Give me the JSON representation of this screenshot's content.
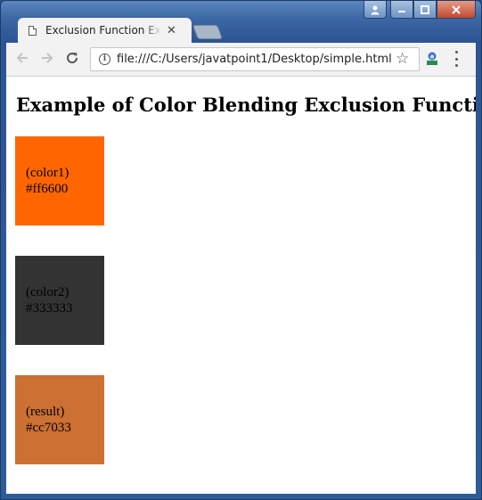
{
  "window": {
    "user_icon": "user-icon",
    "min_icon": "minimize-icon",
    "max_icon": "maximize-icon",
    "close_icon": "close-icon"
  },
  "tab": {
    "title": "Exclusion Function Example",
    "close_label": "✕"
  },
  "toolbar": {
    "url": "file:///C:/Users/javatpoint1/Desktop/simple.html",
    "back_icon": "back-arrow-icon",
    "forward_icon": "forward-arrow-icon",
    "reload_icon": "reload-icon",
    "bookmark_icon": "star-icon",
    "extension_icon": "extension-icon",
    "menu_icon": "menu-icon"
  },
  "page": {
    "heading": "Example of Color Blending Exclusion Function",
    "swatches": [
      {
        "label": "(color1)",
        "value": "#ff6600",
        "color": "#ff6600"
      },
      {
        "label": "(color2)",
        "value": "#333333",
        "color": "#333333"
      },
      {
        "label": "(result)",
        "value": "#cc7033",
        "color": "#cc7033"
      }
    ]
  },
  "colors": {
    "tab_bg": "#f2f2f2",
    "toolbar_bg": "#f2f2f2",
    "page_bg": "#ffffff",
    "frame": "#2f5c99"
  }
}
